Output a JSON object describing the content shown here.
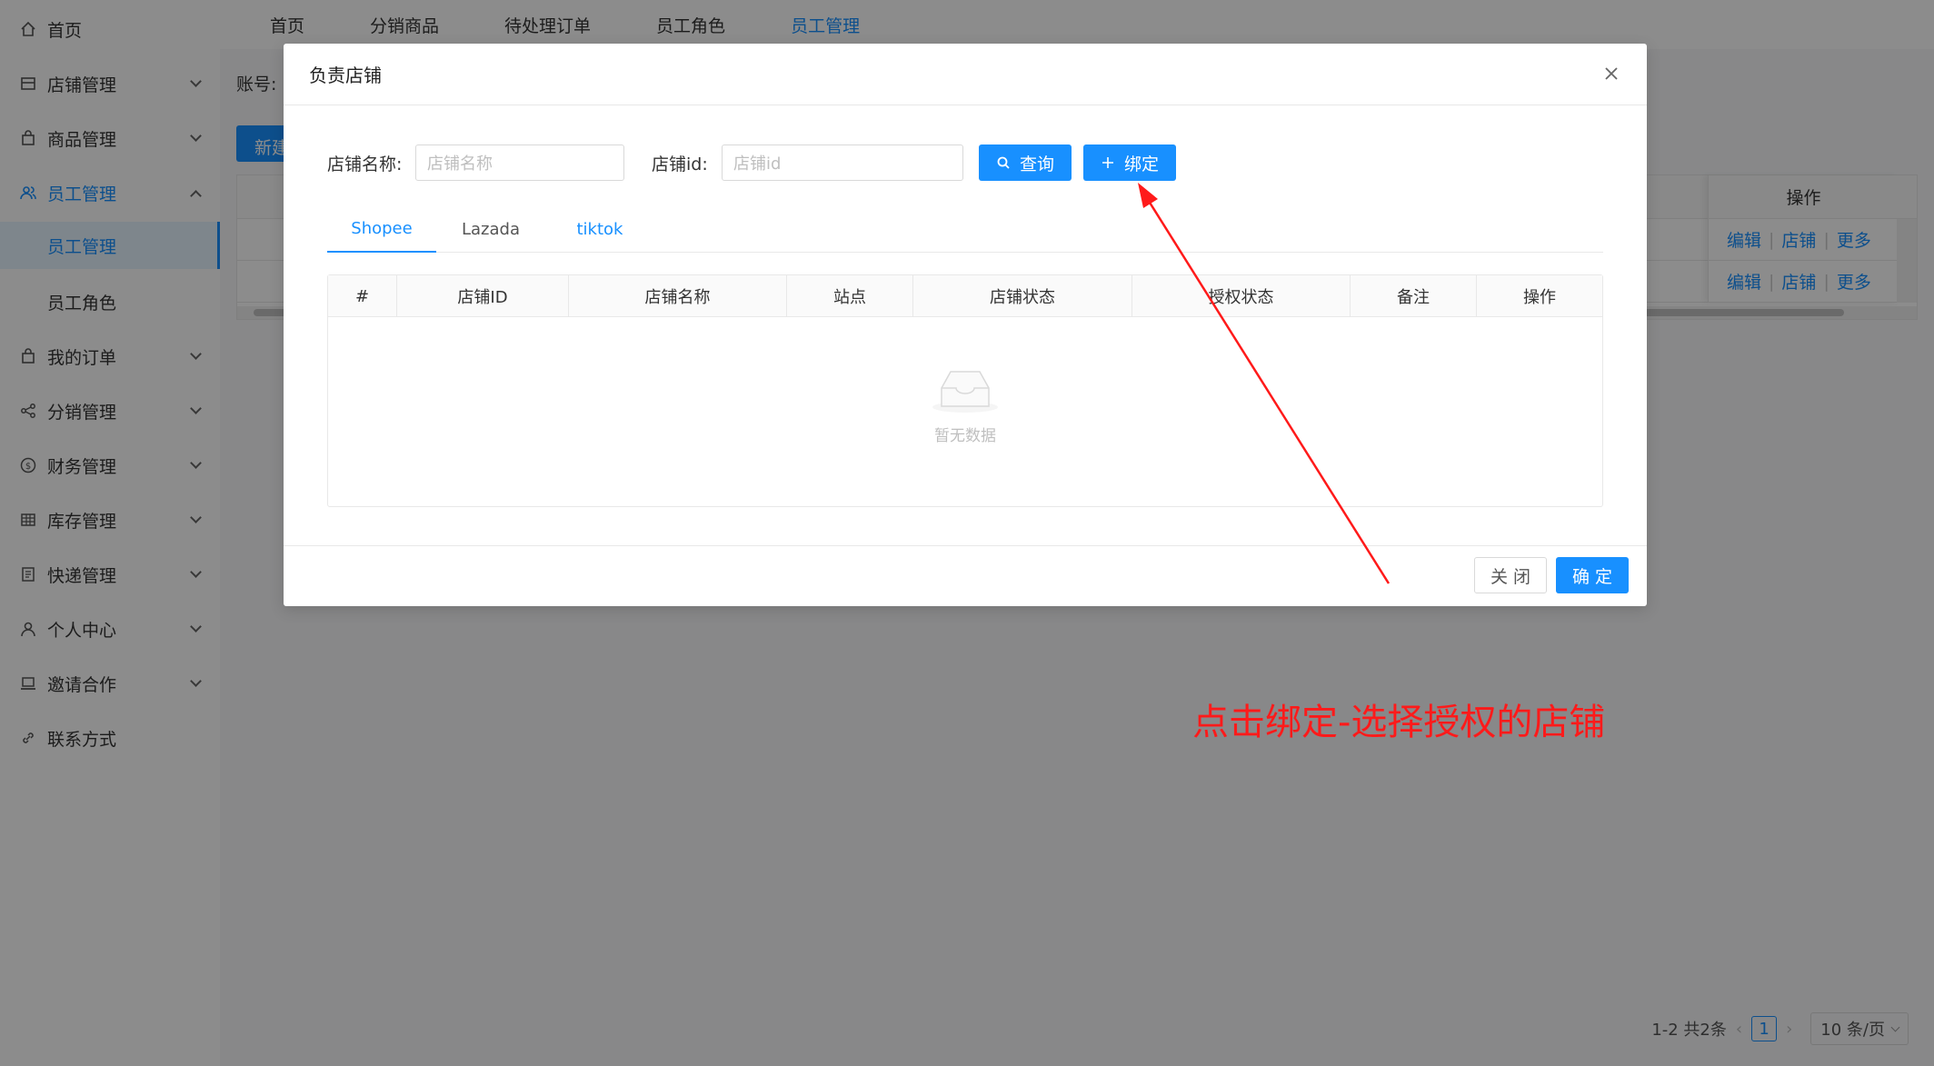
{
  "sidebar": {
    "items": [
      {
        "label": "首页",
        "icon": "home-icon"
      },
      {
        "label": "店铺管理",
        "icon": "store-icon"
      },
      {
        "label": "商品管理",
        "icon": "bag-icon"
      },
      {
        "label": "员工管理",
        "icon": "team-icon"
      },
      {
        "label": "员工管理",
        "icon": ""
      },
      {
        "label": "员工角色",
        "icon": ""
      },
      {
        "label": "我的订单",
        "icon": "bag-icon"
      },
      {
        "label": "分销管理",
        "icon": "share-icon"
      },
      {
        "label": "财务管理",
        "icon": "dollar-icon"
      },
      {
        "label": "库存管理",
        "icon": "grid-icon"
      },
      {
        "label": "快递管理",
        "icon": "list-icon"
      },
      {
        "label": "个人中心",
        "icon": "user-icon"
      },
      {
        "label": "邀请合作",
        "icon": "laptop-icon"
      },
      {
        "label": "联系方式",
        "icon": "link-icon"
      }
    ]
  },
  "topnav": {
    "tabs": [
      "首页",
      "分销商品",
      "待处理订单",
      "员工角色",
      "员工管理"
    ]
  },
  "background": {
    "account_label": "账号:",
    "new_button": "新建",
    "ops_header": "操作",
    "row_actions": {
      "edit": "编辑",
      "shop": "店铺",
      "more": "更多"
    }
  },
  "pagination": {
    "summary": "1-2 共2条",
    "current": "1",
    "page_size": "10 条/页"
  },
  "modal": {
    "title": "负责店铺",
    "shop_name_label": "店铺名称:",
    "shop_name_placeholder": "店铺名称",
    "shop_id_label": "店铺id:",
    "shop_id_placeholder": "店铺id",
    "query_button": "查询",
    "bind_button": "绑定",
    "tabs": [
      "Shopee",
      "Lazada",
      "tiktok"
    ],
    "table_headers": [
      "#",
      "店铺ID",
      "店铺名称",
      "站点",
      "店铺状态",
      "授权状态",
      "备注",
      "操作"
    ],
    "empty_text": "暂无数据",
    "close_button": "关 闭",
    "ok_button": "确 定"
  },
  "annotation": {
    "text": "点击绑定-选择授权的店铺",
    "color": "#ff1a1a"
  },
  "colors": {
    "primary": "#1890ff",
    "mask": "rgba(0,0,0,0.45)"
  }
}
